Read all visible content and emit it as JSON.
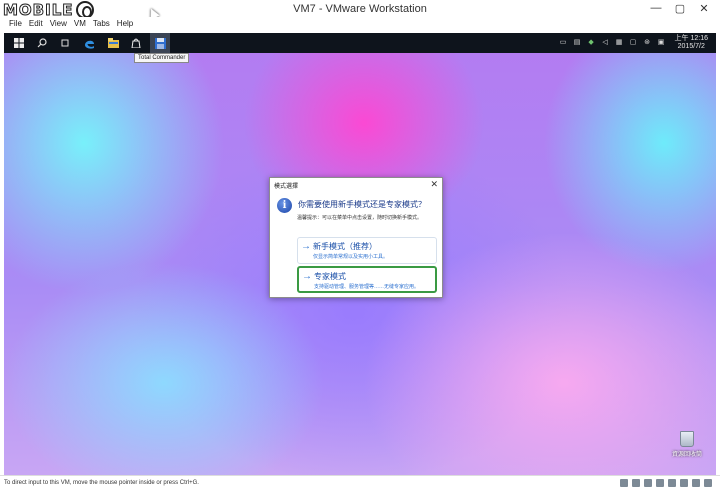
{
  "window": {
    "title": "VM7 - VMware Workstation",
    "logo_text": "MOBILE01",
    "controls": [
      "—",
      "▢",
      "✕"
    ]
  },
  "menu": [
    "File",
    "Edit",
    "View",
    "VM",
    "Tabs",
    "Help"
  ],
  "taskbar": {
    "tooltip": "Total Commander",
    "tray_icons": [
      "language-icon",
      "network-icon",
      "shield-icon",
      "volume-icon",
      "keyboard-icon",
      "notification-icon",
      "settings-icon",
      "display-icon"
    ],
    "clock_time": "上午 12:16",
    "clock_date": "2015/7/2"
  },
  "dialog": {
    "title": "模式選擇",
    "close": "✕",
    "heading": "你需要使用新手模式还是专家模式？",
    "note": "温馨提示：可以在菜单中点击设置，随时切换新手模式。",
    "options": [
      {
        "title": "新手模式（推荐）",
        "desc": "仅显示简单常规以及实用小工具。",
        "selected": false
      },
      {
        "title": "专家模式",
        "desc": "支持驱动管理、服务管理等……无缝专家应用。",
        "selected": true
      }
    ]
  },
  "desktop": {
    "recycle_label": "資源回收筒"
  },
  "status": {
    "text": "To direct input to this VM, move the mouse pointer inside or press Ctrl+G."
  },
  "colors": {
    "selected_border": "#3a9a43",
    "link_blue": "#1a4fa8",
    "taskbar": "#0e141c"
  }
}
